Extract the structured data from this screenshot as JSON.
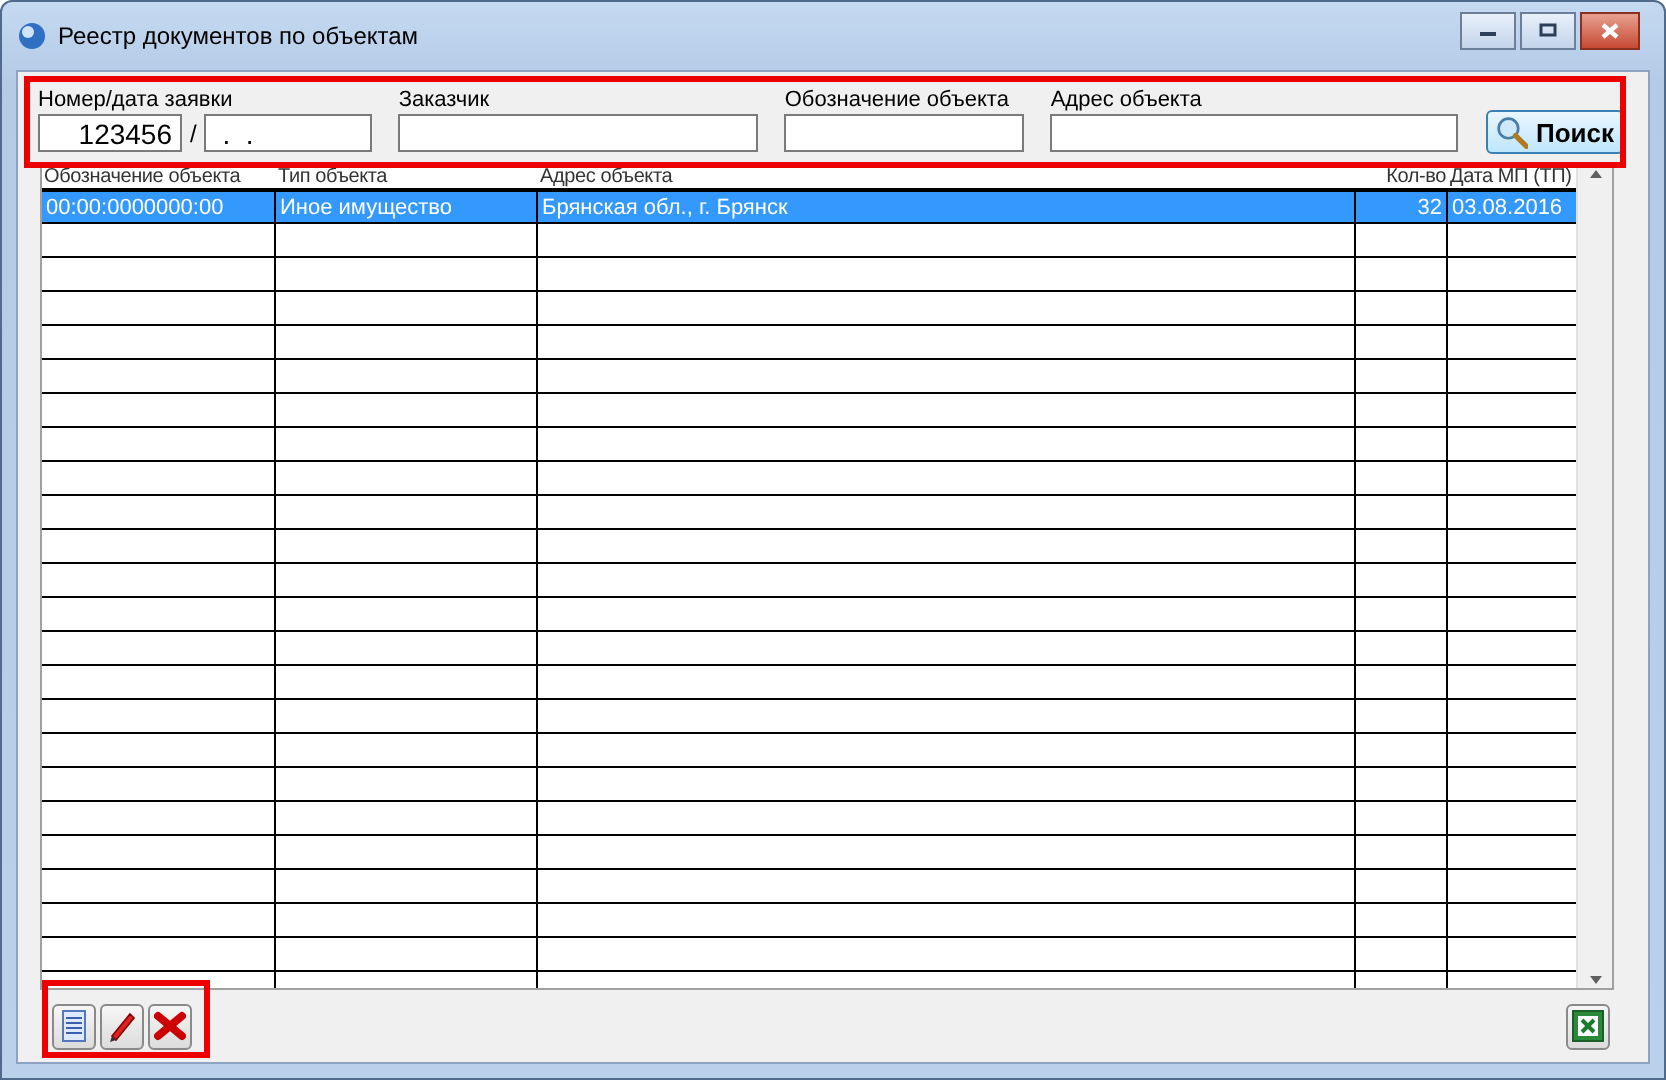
{
  "window": {
    "title": "Реестр документов по объектам"
  },
  "filters": {
    "request": {
      "label": "Номер/дата заявки",
      "number": "123456",
      "separator": "/",
      "date": " .  ."
    },
    "fields": [
      {
        "label": "Заказчик"
      },
      {
        "label": "Обозначение объекта"
      },
      {
        "label": "Адрес объекта"
      }
    ]
  },
  "search_button": {
    "label": "Поиск"
  },
  "table": {
    "columns": [
      {
        "label": "Обозначение объекта",
        "kind": "text"
      },
      {
        "label": "Тип объекта",
        "kind": "text"
      },
      {
        "label": "Адрес объекта",
        "kind": "text"
      },
      {
        "label": "Кол-во",
        "kind": "number"
      },
      {
        "label": "Дата МП (ТП)",
        "kind": "text"
      }
    ],
    "rows": [
      {
        "cells": [
          "00:00:0000000:00",
          "Иное имущество",
          "Брянская обл., г. Брянск",
          "32",
          "03.08.2016"
        ],
        "selected": true
      }
    ]
  }
}
